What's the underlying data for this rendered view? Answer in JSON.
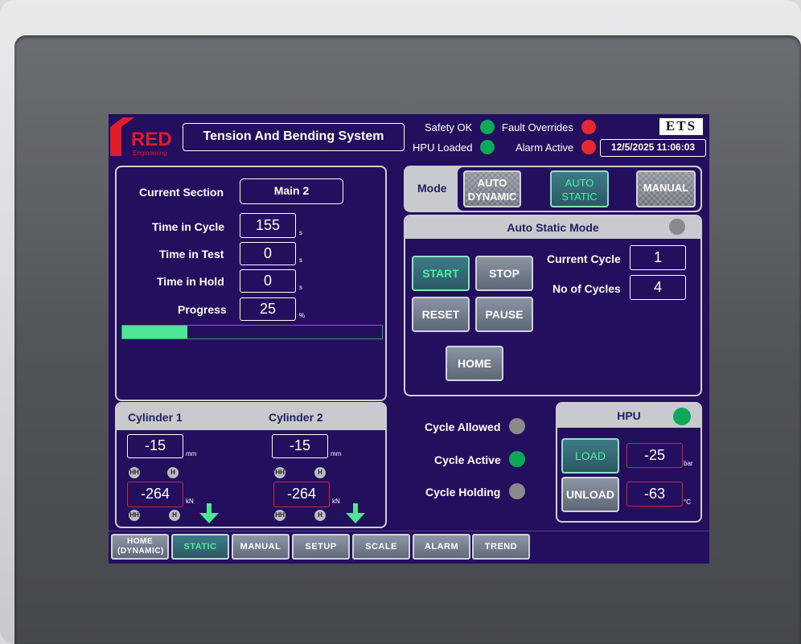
{
  "brand": {
    "logo": "RED",
    "logo_sub": "Engineering"
  },
  "title": "Tension And Bending System",
  "status": {
    "safety_ok": "Safety OK",
    "hpu_loaded": "HPU Loaded",
    "fault_overrides": "Fault Overrides",
    "alarm_active": "Alarm Active",
    "ets": "ETS",
    "datetime": "12/5/2025 11:06:03"
  },
  "left": {
    "current_section_label": "Current Section",
    "current_section_value": "Main 2",
    "time_in_cycle_label": "Time in Cycle",
    "time_in_cycle_value": "155",
    "time_in_test_label": "Time in Test",
    "time_in_test_value": "0",
    "time_in_hold_label": "Time in Hold",
    "time_in_hold_value": "0",
    "progress_label": "Progress",
    "progress_value": "25",
    "unit_s": "s",
    "unit_pct": "%",
    "progress_fraction": 0.25
  },
  "cylinders": {
    "c1_label": "Cylinder 1",
    "c2_label": "Cylinder 2",
    "c1_pos": "-15",
    "c2_pos": "-15",
    "c1_force": "-264",
    "c2_force": "-264",
    "unit_mm": "mm",
    "unit_kn": "kN",
    "tag_hh": "HH",
    "tag_h": "H"
  },
  "mode": {
    "label": "Mode",
    "auto_dynamic": "AUTO DYNAMIC",
    "auto_static": "AUTO STATIC",
    "manual": "MANUAL"
  },
  "auto_static": {
    "title": "Auto Static Mode",
    "start": "START",
    "stop": "STOP",
    "reset": "RESET",
    "pause": "PAUSE",
    "home": "HOME",
    "current_cycle_label": "Current Cycle",
    "current_cycle_value": "1",
    "no_of_cycles_label": "No of Cycles",
    "no_of_cycles_value": "4"
  },
  "cycle_status": {
    "allowed": "Cycle Allowed",
    "active": "Cycle Active",
    "holding": "Cycle Holding"
  },
  "hpu": {
    "title": "HPU",
    "load": "LOAD",
    "unload": "UNLOAD",
    "pressure": "-25",
    "temp": "-63",
    "unit_bar": "bar",
    "unit_c": "°C"
  },
  "nav": {
    "home": "HOME (DYNAMIC)",
    "static": "STATIC",
    "manual": "MANUAL",
    "setup": "SETUP",
    "scale": "SCALE",
    "alarm": "ALARM",
    "trend": "TREND"
  },
  "colors": {
    "screen_bg": "#240e5e",
    "accent_green": "#4bf0a0",
    "led_green": "#0fa85a",
    "led_red": "#e52a33",
    "brand_red": "#e01b2b"
  }
}
